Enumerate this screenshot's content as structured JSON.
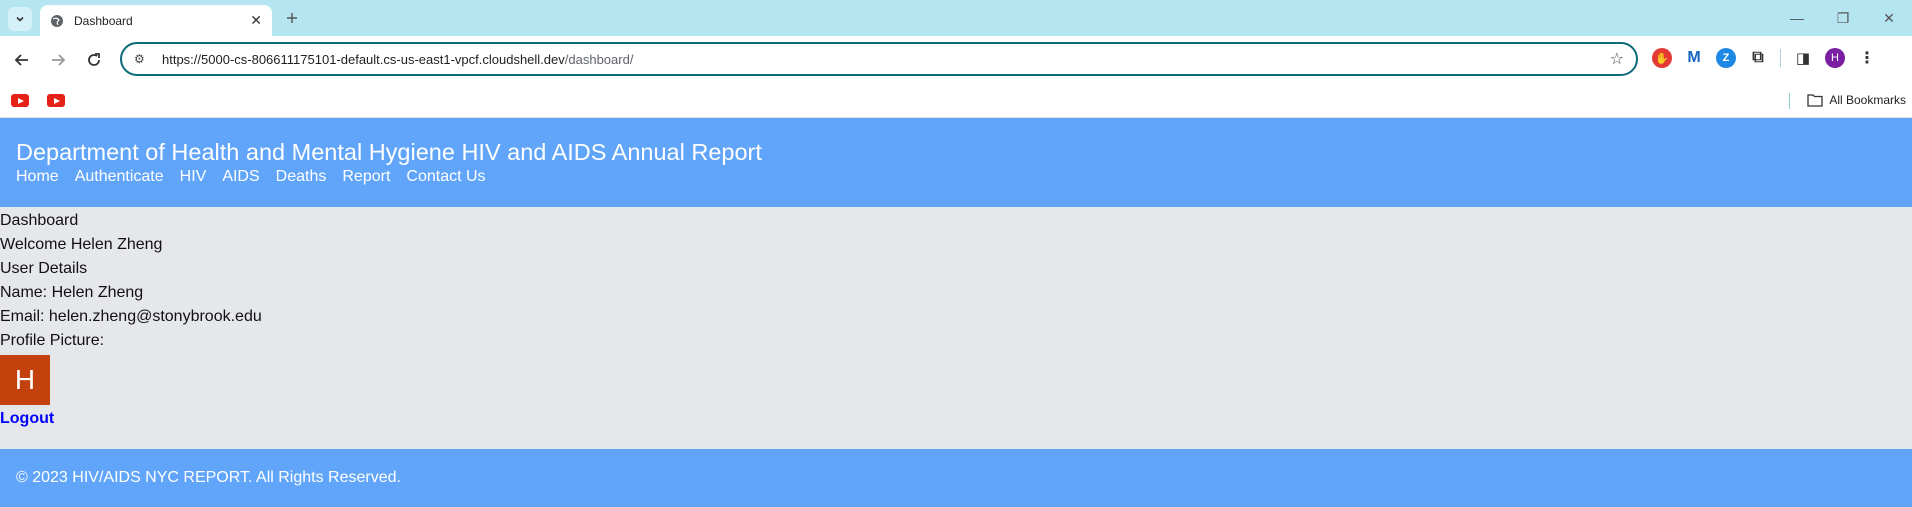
{
  "browser": {
    "tab_title": "Dashboard",
    "url_host": "https://5000-cs-806611175101-default.cs-us-east1-vpcf.cloudshell.dev",
    "url_path": "/dashboard/",
    "profile_initial": "H",
    "all_bookmarks_label": "All Bookmarks",
    "extensions": [
      {
        "name": "adblock-icon",
        "color": "#e53935"
      },
      {
        "name": "malwarebytes-icon",
        "color": "#1565c0"
      },
      {
        "name": "zoom-icon",
        "color": "#1e88e5"
      }
    ]
  },
  "header": {
    "title": "Department of Health and Mental Hygiene HIV and AIDS Annual Report",
    "nav": [
      "Home",
      "Authenticate",
      "HIV",
      "AIDS",
      "Deaths",
      "Report",
      "Contact Us"
    ]
  },
  "dashboard": {
    "heading": "Dashboard",
    "welcome": "Welcome Helen Zheng",
    "section": "User Details",
    "name_line": "Name: Helen Zheng",
    "email_line": "Email: helen.zheng@stonybrook.edu",
    "picture_label": "Profile Picture:",
    "avatar_letter": "H",
    "logout": "Logout"
  },
  "footer": {
    "text": "© 2023 HIV/AIDS NYC REPORT. All Rights Reserved."
  },
  "colors": {
    "header_bg": "#60a5fa",
    "page_bg": "#e5e7eb",
    "avatar_bg": "#c2410c",
    "logout_link": "#0000ff"
  }
}
